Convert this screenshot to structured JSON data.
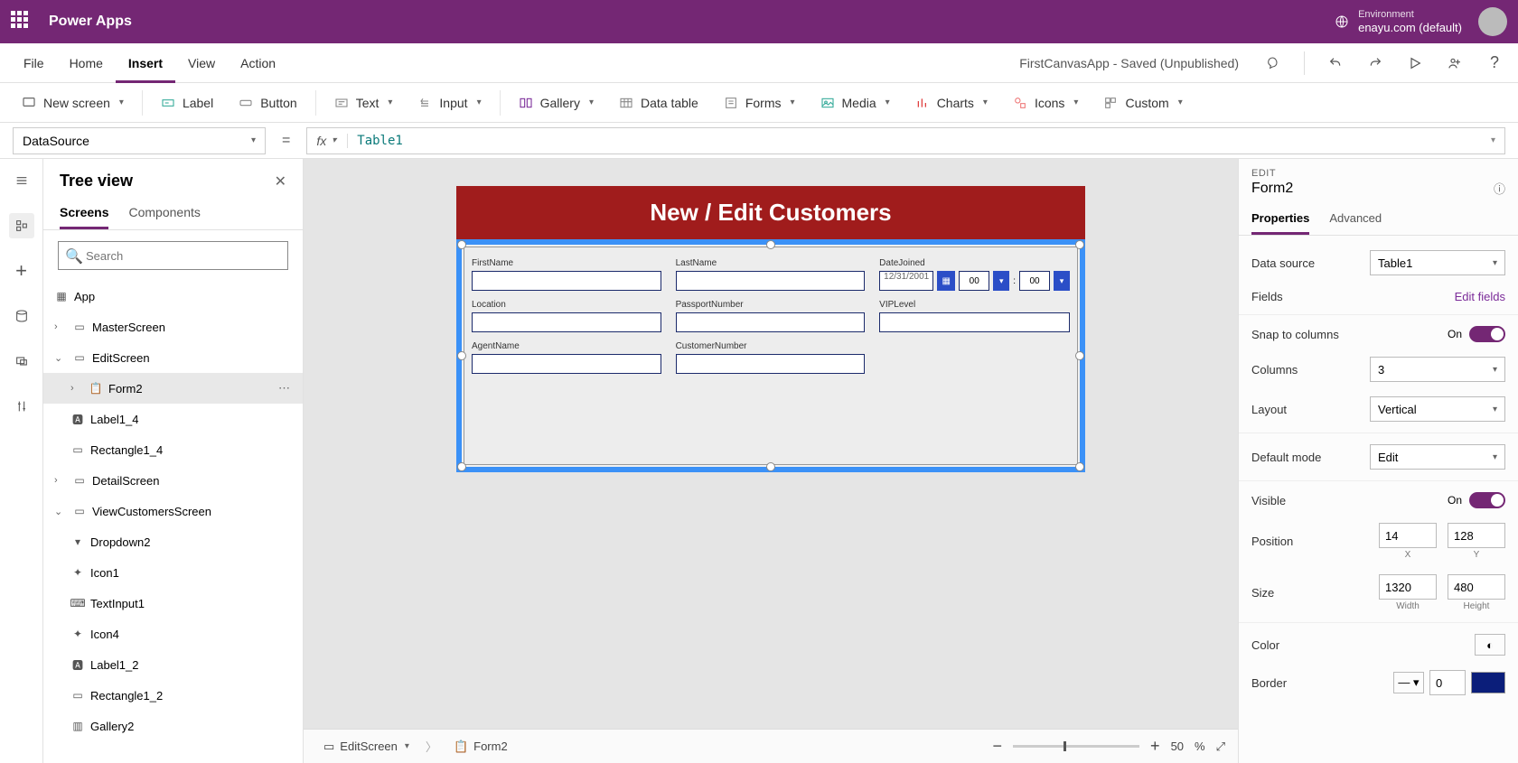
{
  "header": {
    "app_title": "Power Apps",
    "environment_label": "Environment",
    "environment_value": "enayu.com (default)"
  },
  "menu": {
    "items": [
      "File",
      "Home",
      "Insert",
      "View",
      "Action"
    ],
    "active": "Insert",
    "app_status": "FirstCanvasApp - Saved (Unpublished)"
  },
  "ribbon": {
    "new_screen": "New screen",
    "label": "Label",
    "button": "Button",
    "text": "Text",
    "input": "Input",
    "gallery": "Gallery",
    "data_table": "Data table",
    "forms": "Forms",
    "media": "Media",
    "charts": "Charts",
    "icons": "Icons",
    "custom": "Custom"
  },
  "formula": {
    "property": "DataSource",
    "fx": "fx",
    "value": "Table1"
  },
  "tree": {
    "title": "Tree view",
    "tabs": {
      "screens": "Screens",
      "components": "Components"
    },
    "search_placeholder": "Search",
    "items": {
      "app": "App",
      "master": "MasterScreen",
      "edit": "EditScreen",
      "form2": "Form2",
      "label14": "Label1_4",
      "rect14": "Rectangle1_4",
      "detail": "DetailScreen",
      "viewcust": "ViewCustomersScreen",
      "dropdown2": "Dropdown2",
      "icon1": "Icon1",
      "textinput1": "TextInput1",
      "icon4": "Icon4",
      "label12": "Label1_2",
      "rect12": "Rectangle1_2",
      "gallery2": "Gallery2"
    }
  },
  "canvas": {
    "title": "New / Edit Customers",
    "fields": {
      "firstname": "FirstName",
      "lastname": "LastName",
      "datejoined": "DateJoined",
      "location": "Location",
      "passport": "PassportNumber",
      "vip": "VIPLevel",
      "agent": "AgentName",
      "custnum": "CustomerNumber"
    },
    "date_value": "12/31/2001",
    "time_hh": "00",
    "time_mm": "00",
    "crumb_screen": "EditScreen",
    "crumb_form": "Form2",
    "zoom": "50",
    "zoom_pct": "%"
  },
  "props": {
    "type": "EDIT",
    "name": "Form2",
    "tabs": {
      "properties": "Properties",
      "advanced": "Advanced"
    },
    "data_source": "Data source",
    "data_source_val": "Table1",
    "fields": "Fields",
    "edit_fields": "Edit fields",
    "snap": "Snap to columns",
    "on": "On",
    "columns": "Columns",
    "columns_val": "3",
    "layout": "Layout",
    "layout_val": "Vertical",
    "default_mode": "Default mode",
    "default_mode_val": "Edit",
    "visible": "Visible",
    "position": "Position",
    "pos_x": "14",
    "pos_y": "128",
    "x_label": "X",
    "y_label": "Y",
    "size": "Size",
    "width": "1320",
    "height": "480",
    "width_label": "Width",
    "height_label": "Height",
    "color": "Color",
    "border": "Border",
    "border_val": "0"
  }
}
